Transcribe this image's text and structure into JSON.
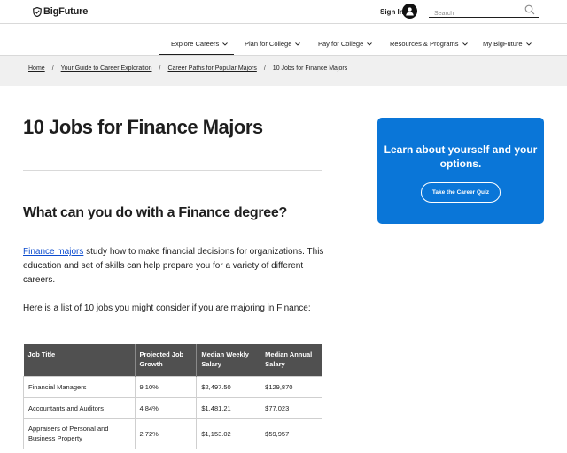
{
  "header": {
    "logo": "BigFuture",
    "signin": "Sign In",
    "search": {
      "placeholder": "Search",
      "value": ""
    }
  },
  "nav": {
    "items": [
      {
        "label": "Explore Careers"
      },
      {
        "label": "Plan for College"
      },
      {
        "label": "Pay for College"
      },
      {
        "label": "Resources & Programs"
      },
      {
        "label": "My BigFuture"
      }
    ],
    "active": "Explore Careers"
  },
  "breadcrumb": [
    {
      "label": "Home"
    },
    {
      "label": "Your Guide to Career Exploration"
    },
    {
      "label": "Career Paths for Popular Majors"
    },
    {
      "label": "10 Jobs for Finance Majors"
    }
  ],
  "page": {
    "title": "10 Jobs for Finance Majors",
    "section_title": "What can you do with a Finance degree?",
    "intro_link": "Finance majors",
    "intro_rest": " study how to make financial decisions for organizations. This education and set of skills can help prepare you for a variety of different careers.",
    "list_intro": "Here is a list of 10 jobs you might consider if you are majoring in Finance:"
  },
  "table": {
    "headers": [
      "Job Title",
      "Projected Job Growth",
      "Median Weekly Salary",
      "Median Annual Salary"
    ],
    "rows": [
      [
        "Financial Managers",
        "9.10%",
        "$2,497.50",
        "$129,870"
      ],
      [
        "Accountants and Auditors",
        "4.84%",
        "$1,481.21",
        "$77,023"
      ],
      [
        "Appraisers of Personal and Business Property",
        "2.72%",
        "$1,153.02",
        "$59,957"
      ]
    ]
  },
  "cta": {
    "text": "Learn about yourself and your options.",
    "button": "Take the Career Quiz"
  },
  "colors": {
    "accent": "#0a76d8",
    "link": "#0c4ccf",
    "table_header": "#505050"
  }
}
